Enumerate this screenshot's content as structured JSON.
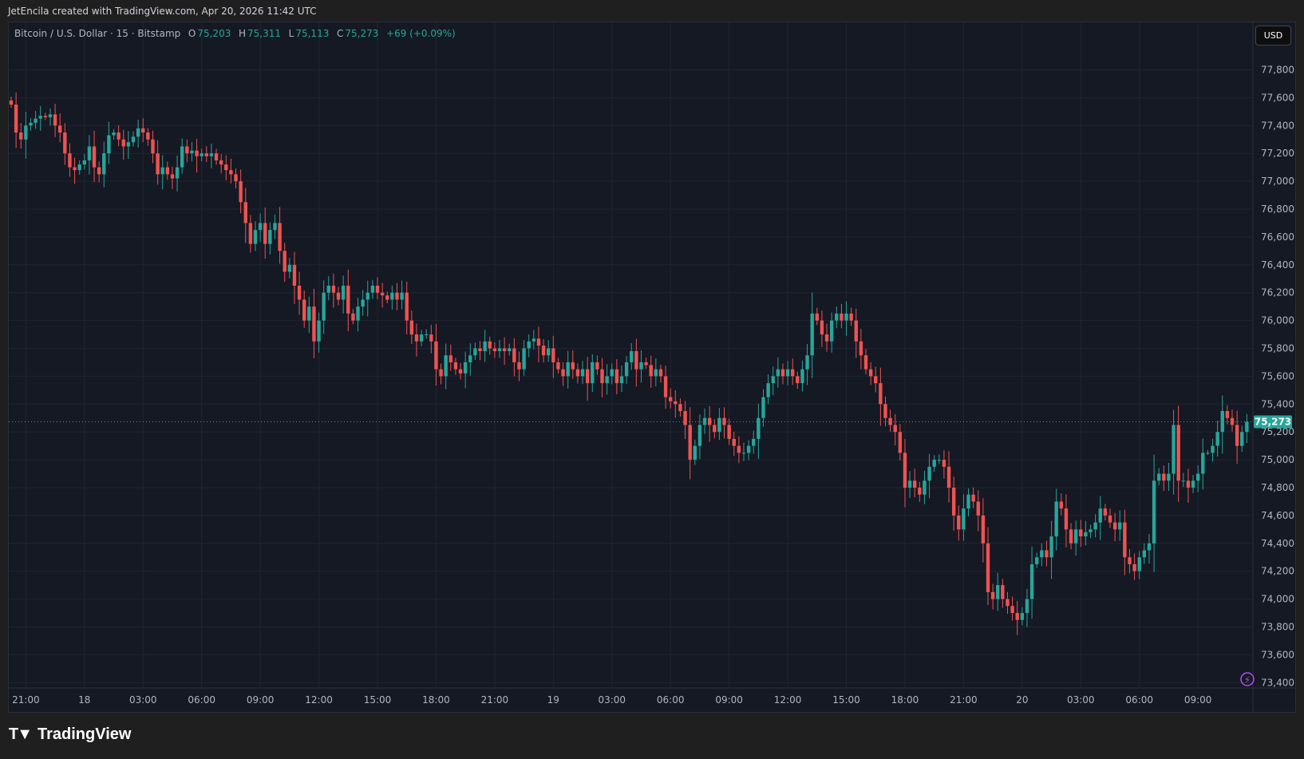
{
  "credit": "JetEncila created with TradingView.com, Apr 20, 2026 11:42 UTC",
  "legend": {
    "symbol": "Bitcoin / U.S. Dollar · 15 · Bitstamp",
    "o_label": "O",
    "o": "75,203",
    "h_label": "H",
    "h": "75,311",
    "l_label": "L",
    "l": "75,113",
    "c_label": "C",
    "c": "75,273",
    "change": "+69 (+0.09%)"
  },
  "currency_button": "USD",
  "current_price_label": "75,273",
  "brand": "TradingView",
  "colors": {
    "up": "#26a69a",
    "down": "#ef5350",
    "background": "#151924",
    "grid": "#212532"
  },
  "chart_data": {
    "type": "candlestick",
    "title": "Bitcoin / U.S. Dollar · 15 · Bitstamp",
    "interval_minutes": 15,
    "ylim": [
      73300,
      77950
    ],
    "yticks": [
      77800,
      77600,
      77400,
      77200,
      77000,
      76800,
      76600,
      76400,
      76200,
      76000,
      75800,
      75600,
      75400,
      75200,
      75000,
      74800,
      74600,
      74400,
      74200,
      74000,
      73800,
      73600,
      73400
    ],
    "xtick_labels": [
      "21:00",
      "18",
      "03:00",
      "06:00",
      "09:00",
      "12:00",
      "15:00",
      "18:00",
      "21:00",
      "19",
      "03:00",
      "06:00",
      "09:00",
      "12:00",
      "15:00",
      "18:00",
      "21:00",
      "20",
      "03:00",
      "06:00",
      "09:00"
    ],
    "first_xtick_candle_index": 3,
    "candles_per_xtick": 12,
    "current_price": 75273,
    "first_open": 77580,
    "closes": [
      77550,
      77350,
      77300,
      77400,
      77420,
      77450,
      77470,
      77460,
      77480,
      77400,
      77350,
      77200,
      77100,
      77080,
      77120,
      77150,
      77250,
      77100,
      77050,
      77200,
      77330,
      77350,
      77300,
      77250,
      77280,
      77320,
      77380,
      77350,
      77300,
      77200,
      77050,
      77100,
      77050,
      77020,
      77100,
      77250,
      77200,
      77220,
      77180,
      77200,
      77180,
      77200,
      77150,
      77120,
      77080,
      77050,
      77000,
      76850,
      76700,
      76550,
      76650,
      76700,
      76550,
      76650,
      76700,
      76500,
      76350,
      76400,
      76250,
      76150,
      76000,
      76100,
      75850,
      76000,
      76200,
      76250,
      76200,
      76150,
      76250,
      76050,
      76000,
      76100,
      76150,
      76200,
      76250,
      76200,
      76180,
      76150,
      76200,
      76150,
      76200,
      76000,
      75900,
      75850,
      75900,
      75900,
      75850,
      75650,
      75600,
      75750,
      75700,
      75650,
      75620,
      75700,
      75750,
      75800,
      75780,
      75850,
      75800,
      75780,
      75800,
      75780,
      75800,
      75700,
      75650,
      75800,
      75850,
      75870,
      75820,
      75750,
      75800,
      75700,
      75650,
      75600,
      75700,
      75650,
      75600,
      75650,
      75550,
      75700,
      75650,
      75550,
      75600,
      75650,
      75550,
      75600,
      75700,
      75780,
      75650,
      75700,
      75680,
      75600,
      75650,
      75600,
      75450,
      75420,
      75400,
      75350,
      75250,
      75000,
      75100,
      75250,
      75300,
      75250,
      75200,
      75300,
      75250,
      75150,
      75100,
      75050,
      75050,
      75100,
      75150,
      75300,
      75450,
      75550,
      75600,
      75650,
      75600,
      75650,
      75600,
      75550,
      75650,
      75750,
      76050,
      76000,
      75900,
      75850,
      76000,
      76050,
      76000,
      76050,
      76000,
      75850,
      75750,
      75650,
      75600,
      75550,
      75400,
      75300,
      75250,
      75200,
      75050,
      74800,
      74850,
      74800,
      74750,
      74850,
      74950,
      75000,
      75000,
      74950,
      74800,
      74600,
      74500,
      74650,
      74750,
      74700,
      74600,
      74400,
      74050,
      74000,
      74100,
      74000,
      73950,
      73900,
      73850,
      73900,
      74000,
      74250,
      74300,
      74350,
      74300,
      74450,
      74700,
      74650,
      74500,
      74400,
      74500,
      74450,
      74480,
      74500,
      74550,
      74650,
      74600,
      74550,
      74500,
      74550,
      74300,
      74250,
      74200,
      74300,
      74350,
      74400,
      74850,
      74900,
      74850,
      74900,
      75250,
      74850,
      74850,
      74800,
      74850,
      74900,
      75050,
      75050,
      75100,
      75200,
      75350,
      75300,
      75250,
      75100,
      75200,
      75273
    ]
  }
}
